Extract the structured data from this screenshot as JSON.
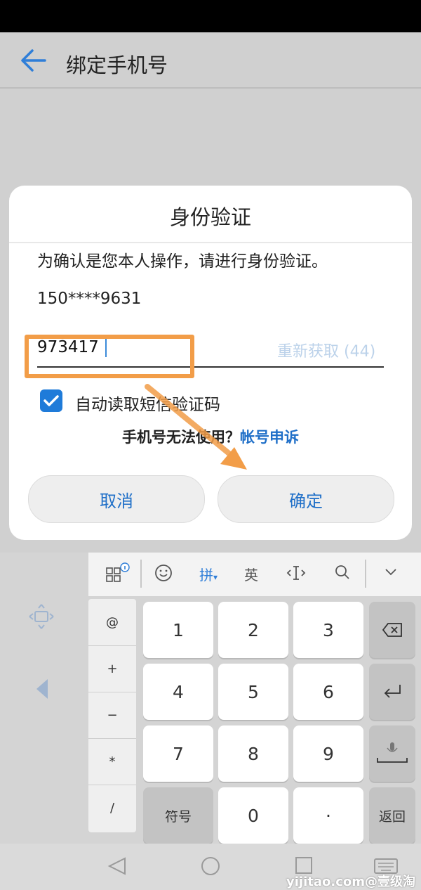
{
  "app": {
    "title": "绑定手机号"
  },
  "dialog": {
    "title": "身份验证",
    "description": "为确认是您本人操作，请进行身份验证。",
    "phone_masked": "150****9631",
    "code_value": "973417",
    "resend_label": "重新获取 (44)",
    "auto_read_label": "自动读取短信验证码",
    "auto_read_checked": true,
    "help_question": "手机号无法使用？",
    "help_link": "帐号申诉",
    "cancel_label": "取消",
    "confirm_label": "确定"
  },
  "keyboard": {
    "toolbar": {
      "pinyin": "拼",
      "english": "英"
    },
    "symbols": [
      "@",
      "+",
      "−",
      "*",
      "/"
    ],
    "digits": [
      "1",
      "2",
      "3",
      "4",
      "5",
      "6",
      "7",
      "8",
      "9"
    ],
    "symbols_key": "符号",
    "zero": "0",
    "dot": "·",
    "return_key": "返回"
  },
  "watermark": "yijitao.com@壹级淘",
  "colors": {
    "accent": "#1f7bd9",
    "highlight": "#f29d48"
  }
}
